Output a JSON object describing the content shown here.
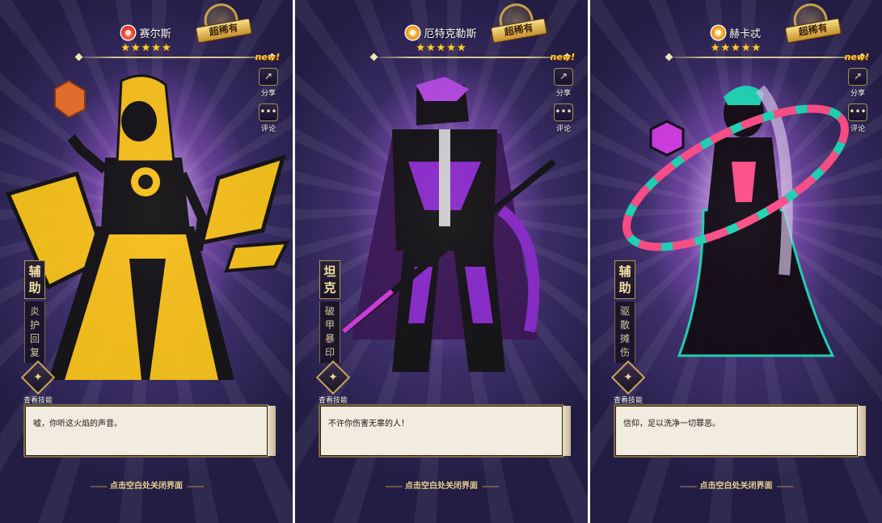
{
  "panels": [
    {
      "name": "赛尔斯",
      "element_icon": "fire-element-icon",
      "stars": "★★★★★",
      "rarity_badge": "超稀有",
      "new_tag": "new!",
      "share_label": "分享",
      "comment_label": "评论",
      "role": [
        "辅",
        "助"
      ],
      "role_desc": [
        "炎",
        "护",
        "回",
        "复"
      ],
      "skill_label": "查看技能",
      "quote": "嘘，你听这火焰的声音。",
      "close_hint": "点击空白处关闭界面",
      "palette": {
        "primary": "#f7c21a",
        "secondary": "#141414",
        "accent": "#e8702a"
      }
    },
    {
      "name": "厄特克勒斯",
      "element_icon": "sun-element-icon",
      "stars": "★★★★★",
      "rarity_badge": "超稀有",
      "new_tag": "new!",
      "share_label": "分享",
      "comment_label": "评论",
      "role": [
        "坦",
        "克"
      ],
      "role_desc": [
        "破",
        "甲",
        "暴",
        "印"
      ],
      "skill_label": "查看技能",
      "quote": "不许你伤害无辜的人！",
      "close_hint": "点击空白处关闭界面",
      "palette": {
        "primary": "#8a2cc9",
        "secondary": "#111111",
        "accent": "#d13ce0"
      }
    },
    {
      "name": "赫卡忒",
      "element_icon": "sun-element-icon",
      "stars": "★★★★★",
      "rarity_badge": "超稀有",
      "new_tag": "new!",
      "share_label": "分享",
      "comment_label": "评论",
      "role": [
        "辅",
        "助"
      ],
      "role_desc": [
        "驱",
        "散",
        "摊",
        "伤"
      ],
      "skill_label": "查看技能",
      "quote": "信仰，足以洗净一切罪恶。",
      "close_hint": "点击空白处关闭界面",
      "palette": {
        "primary": "#1fd6b4",
        "secondary": "#120d14",
        "accent": "#ff4f86"
      }
    }
  ]
}
